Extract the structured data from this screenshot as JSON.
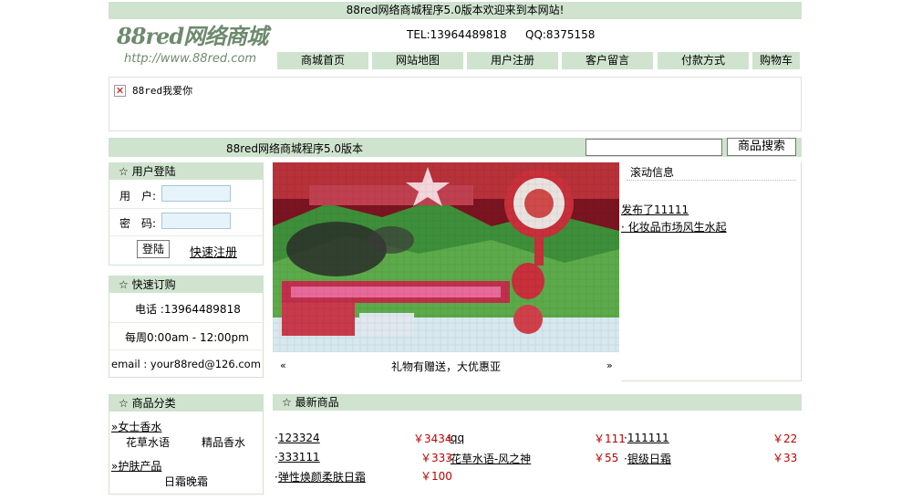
{
  "topbar": {
    "text": "88red网络商城程序5.0版本欢迎来到本网站!"
  },
  "header": {
    "logo_title": "88red网络商城",
    "logo_url": "http://www.88red.com",
    "tel": "TEL:13964489818",
    "qq": "QQ:8375158"
  },
  "nav": [
    "商城首页",
    "网站地图",
    "用户注册",
    "客户留言",
    "付款方式",
    "购物车"
  ],
  "banner": {
    "broken_image_alt": "88red我爱你"
  },
  "searchbar": {
    "label": "88red网络商城程序5.0版本",
    "placeholder": "",
    "button": "商品搜索"
  },
  "login": {
    "title": "用户登陆",
    "user_label": "用　户:",
    "pass_label": "密　码:",
    "submit": "登陆",
    "register": "快速注册"
  },
  "order": {
    "title": "快速订购",
    "phone": "电话 :13964489818",
    "hours": "每周0:00am - 12:00pm",
    "email": "email : your88red@126.com"
  },
  "slideshow": {
    "caption": "礼物有赠送，大优惠亚",
    "prev": "«",
    "next": "»"
  },
  "news": {
    "title": "滚动信息",
    "items": [
      "发布了11111",
      "· 化妆品市场风生水起"
    ]
  },
  "categories": {
    "title": "商品分类",
    "groups": [
      {
        "name": "»女士香水",
        "subs": [
          "花草水语",
          "精品香水"
        ]
      },
      {
        "name": "»护肤产品",
        "subs": [
          "日霜晚霜"
        ]
      }
    ]
  },
  "latest": {
    "title": "最新商品",
    "items": [
      {
        "name": "123324",
        "price": "￥3434"
      },
      {
        "name": "qq",
        "price": "￥111"
      },
      {
        "name": "111111",
        "price": "￥22"
      },
      {
        "name": "333111",
        "price": "￥333"
      },
      {
        "name": "花草水语-风之神",
        "price": "￥55"
      },
      {
        "name": "银级日霜",
        "price": "￥33"
      },
      {
        "name": "弹性焕颜柔肤日霜",
        "price": "￥100"
      }
    ]
  },
  "colors": {
    "accent_green": "#cfe3cf",
    "price_red": "#c00000",
    "logo_green": "#6e8a6e"
  },
  "icons": {
    "star": "☆",
    "broken_image": "broken-image-icon"
  }
}
